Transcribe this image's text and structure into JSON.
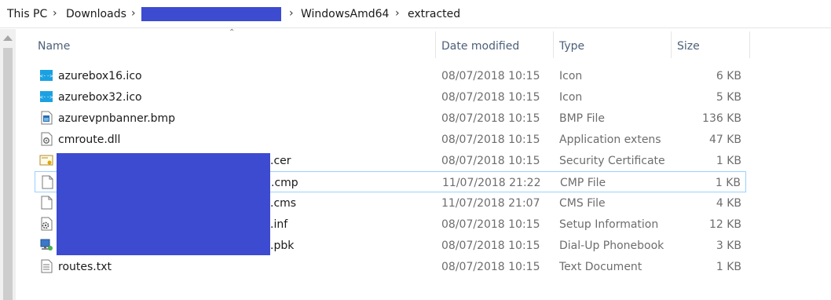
{
  "breadcrumb": {
    "items": [
      "This PC",
      "Downloads",
      "WindowsAmd64",
      "extracted"
    ],
    "separator": "›"
  },
  "columns": {
    "name": "Name",
    "date_modified": "Date modified",
    "type": "Type",
    "size": "Size"
  },
  "files": [
    {
      "name": "azurebox16.ico",
      "date": "08/07/2018 10:15",
      "type": "Icon",
      "size": "6 KB",
      "icon": "azure-vpn-icon"
    },
    {
      "name": "azurebox32.ico",
      "date": "08/07/2018 10:15",
      "type": "Icon",
      "size": "5 KB",
      "icon": "azure-vpn-icon"
    },
    {
      "name": "azurevpnbanner.bmp",
      "date": "08/07/2018 10:15",
      "type": "BMP File",
      "size": "136 KB",
      "icon": "bitmap-file-icon"
    },
    {
      "name": "cmroute.dll",
      "date": "08/07/2018 10:15",
      "type": "Application extens",
      "size": "47 KB",
      "icon": "dll-file-icon"
    },
    {
      "name": ".cer",
      "date": "08/07/2018 10:15",
      "type": "Security Certificate",
      "size": "1 KB",
      "icon": "certificate-file-icon"
    },
    {
      "name": ".cmp",
      "date": "11/07/2018 21:22",
      "type": "CMP File",
      "size": "1 KB",
      "icon": "blank-file-icon"
    },
    {
      "name": ".cms",
      "date": "11/07/2018 21:07",
      "type": "CMS File",
      "size": "4 KB",
      "icon": "blank-file-icon"
    },
    {
      "name": ".inf",
      "date": "08/07/2018 10:15",
      "type": "Setup Information",
      "size": "12 KB",
      "icon": "setup-info-file-icon"
    },
    {
      "name": ".pbk",
      "date": "08/07/2018 10:15",
      "type": "Dial-Up Phonebook",
      "size": "3 KB",
      "icon": "phonebook-file-icon"
    },
    {
      "name": "routes.txt",
      "date": "08/07/2018 10:15",
      "type": "Text Document",
      "size": "1 KB",
      "icon": "text-file-icon"
    }
  ],
  "colors": {
    "redaction": "#3d4bd0",
    "header_text": "#4c607a",
    "selection_border": "#99d1ff",
    "azure_icon": "#1ba1e2"
  }
}
